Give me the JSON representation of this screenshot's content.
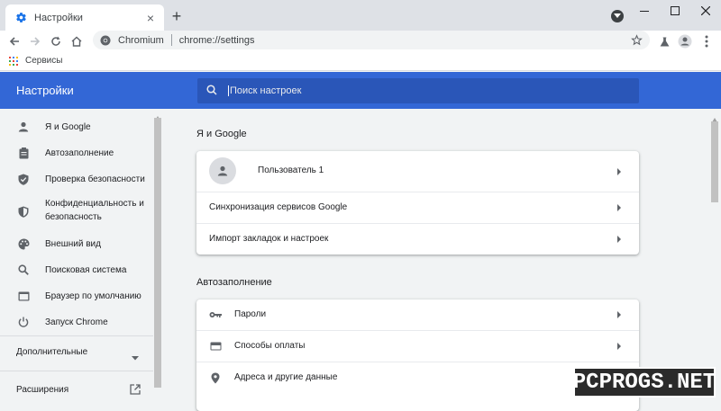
{
  "browser": {
    "tab_title": "Настройки",
    "new_tab_symbol": "+",
    "close_tab_symbol": "×",
    "site_name": "Chromium",
    "url": "chrome://settings",
    "bookmarks_label": "Сервисы"
  },
  "header": {
    "title": "Настройки",
    "search_placeholder": "Поиск настроек"
  },
  "sidebar": {
    "items": [
      {
        "label": "Я и Google",
        "icon": "person-icon"
      },
      {
        "label": "Автозаполнение",
        "icon": "clipboard-icon"
      },
      {
        "label": "Проверка безопасности",
        "icon": "shield-check-icon"
      },
      {
        "label": "Конфиденциальность и безопасность",
        "icon": "shield-icon"
      },
      {
        "label": "Внешний вид",
        "icon": "palette-icon"
      },
      {
        "label": "Поисковая система",
        "icon": "search-icon"
      },
      {
        "label": "Браузер по умолчанию",
        "icon": "browser-icon"
      },
      {
        "label": "Запуск Chrome",
        "icon": "power-icon"
      }
    ],
    "advanced_label": "Дополнительные",
    "extensions_label": "Расширения"
  },
  "main": {
    "sections": [
      {
        "title": "Я и Google",
        "rows": [
          {
            "label": "Пользователь 1",
            "icon": "avatar-icon"
          },
          {
            "label": "Синхронизация сервисов Google"
          },
          {
            "label": "Импорт закладок и настроек"
          }
        ]
      },
      {
        "title": "Автозаполнение",
        "rows": [
          {
            "label": "Пароли",
            "icon": "key-icon"
          },
          {
            "label": "Способы оплаты",
            "icon": "credit-card-icon"
          },
          {
            "label": "Адреса и другие данные",
            "icon": "location-pin-icon"
          }
        ]
      }
    ]
  },
  "watermark": "PCPROGS.NET",
  "colors": {
    "header_blue": "#3367d6",
    "search_blue": "#2a56b8",
    "page_bg": "#f1f3f4",
    "card_bg": "#ffffff",
    "tab_bg": "#dee1e6"
  }
}
